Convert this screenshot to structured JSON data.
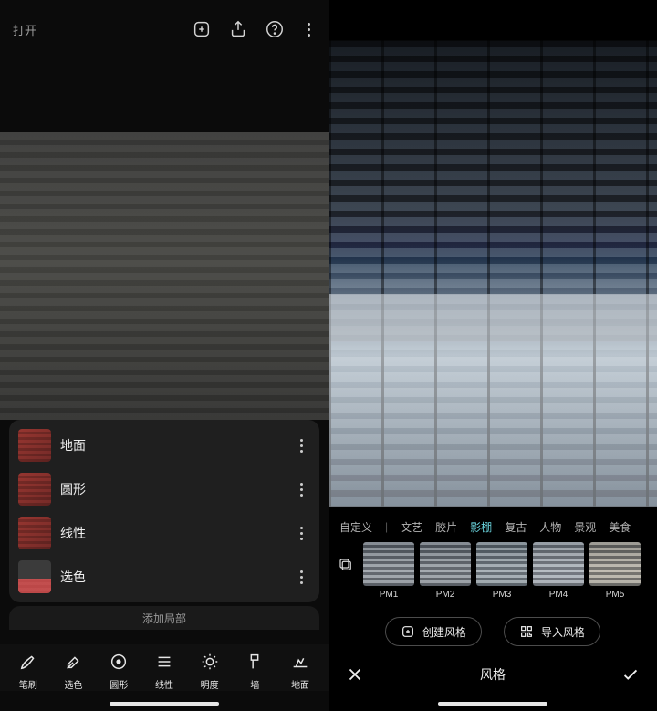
{
  "left": {
    "open_label": "打开",
    "layers": [
      {
        "name": "地面",
        "thumb": "red"
      },
      {
        "name": "圆形",
        "thumb": "red"
      },
      {
        "name": "线性",
        "thumb": "red"
      },
      {
        "name": "选色",
        "thumb": "pick"
      }
    ],
    "add_local_label": "添加局部",
    "tools": [
      {
        "id": "brush",
        "label": "笔刷"
      },
      {
        "id": "pick-color",
        "label": "选色"
      },
      {
        "id": "round",
        "label": "圆形"
      },
      {
        "id": "linear",
        "label": "线性"
      },
      {
        "id": "brightness",
        "label": "明度"
      },
      {
        "id": "wall",
        "label": "墙"
      },
      {
        "id": "ground",
        "label": "地面"
      }
    ]
  },
  "right": {
    "tabs": [
      "自定义",
      "文艺",
      "胶片",
      "影棚",
      "复古",
      "人物",
      "景观",
      "美食"
    ],
    "active_tab_index": 3,
    "presets": [
      {
        "id": "PM1",
        "label": "PM1"
      },
      {
        "id": "PM2",
        "label": "PM2"
      },
      {
        "id": "PM3",
        "label": "PM3"
      },
      {
        "id": "PM4",
        "label": "PM4"
      },
      {
        "id": "PM5",
        "label": "PM5"
      }
    ],
    "create_style_label": "创建风格",
    "import_style_label": "导入风格",
    "panel_title": "风格"
  }
}
